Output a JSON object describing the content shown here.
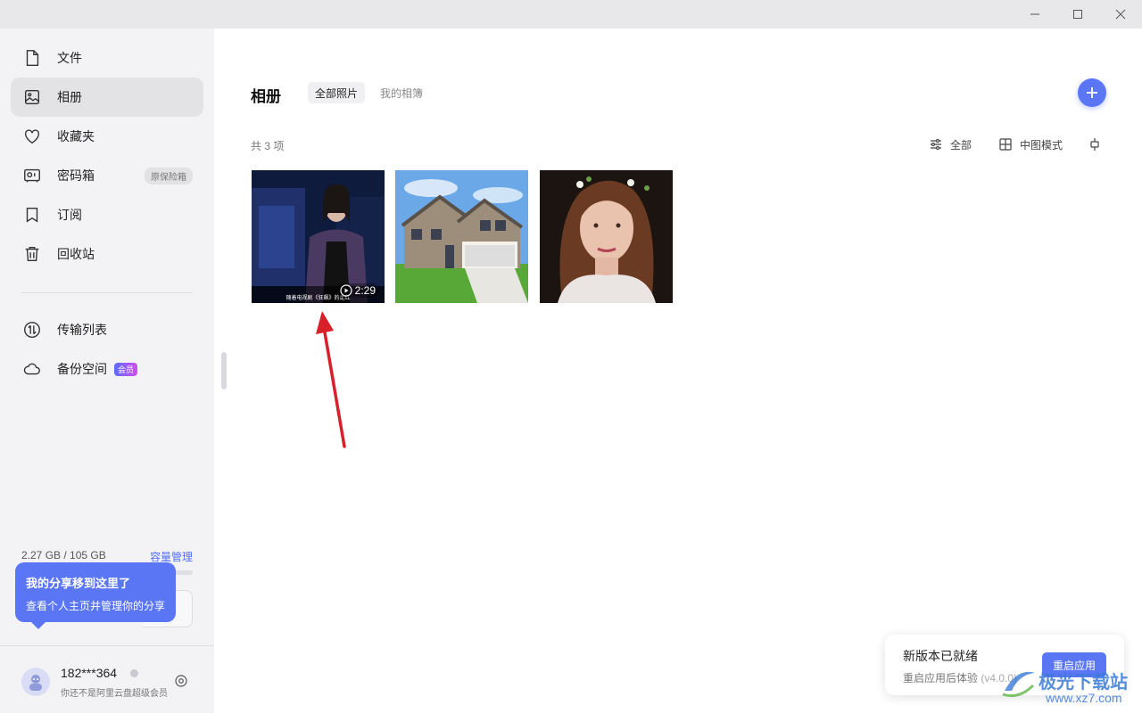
{
  "window": {
    "minimize": "minimize",
    "maximize": "maximize",
    "close": "close"
  },
  "sidebar": {
    "items": [
      {
        "label": "文件",
        "icon": "file-icon"
      },
      {
        "label": "相册",
        "icon": "album-icon",
        "active": true
      },
      {
        "label": "收藏夹",
        "icon": "heart-icon"
      },
      {
        "label": "密码箱",
        "icon": "safe-icon",
        "tag": "原保险箱"
      },
      {
        "label": "订阅",
        "icon": "bookmark-icon"
      },
      {
        "label": "回收站",
        "icon": "trash-icon"
      },
      {
        "label": "传输列表",
        "icon": "transfer-icon"
      },
      {
        "label": "备份空间",
        "icon": "cloud-icon",
        "tag": "会员"
      }
    ],
    "storage": {
      "text": "2.27 GB / 105 GB",
      "link": "容量管理",
      "used_fraction": 0.022
    },
    "tooltip": {
      "title": "我的分享移到这里了",
      "body": "查看个人主页并管理你的分享"
    },
    "user": {
      "name": "182***364",
      "subtitle": "你还不是阿里云盘超级会员"
    }
  },
  "main": {
    "title": "相册",
    "tabs": [
      {
        "label": "全部照片",
        "active": true
      },
      {
        "label": "我的相簿",
        "active": false
      }
    ],
    "count": "共 3 项",
    "tools": {
      "filter": "全部",
      "view": "中图模式"
    },
    "photos": [
      {
        "type": "video",
        "duration": "2:29",
        "caption": "随着电视剧《狂飙》的走红"
      },
      {
        "type": "image",
        "desc": "house"
      },
      {
        "type": "image",
        "desc": "portrait"
      }
    ]
  },
  "update": {
    "title": "新版本已就绪",
    "subtitle": "重启应用后体验",
    "version": "(v4.0.0)",
    "button": "重启应用"
  },
  "watermark": {
    "text": "极光下载站",
    "url": "www.xz7.com"
  },
  "colors": {
    "accent": "#5b76f5",
    "arrow": "#d8202a",
    "sidebar_bg": "#f3f3f5"
  }
}
